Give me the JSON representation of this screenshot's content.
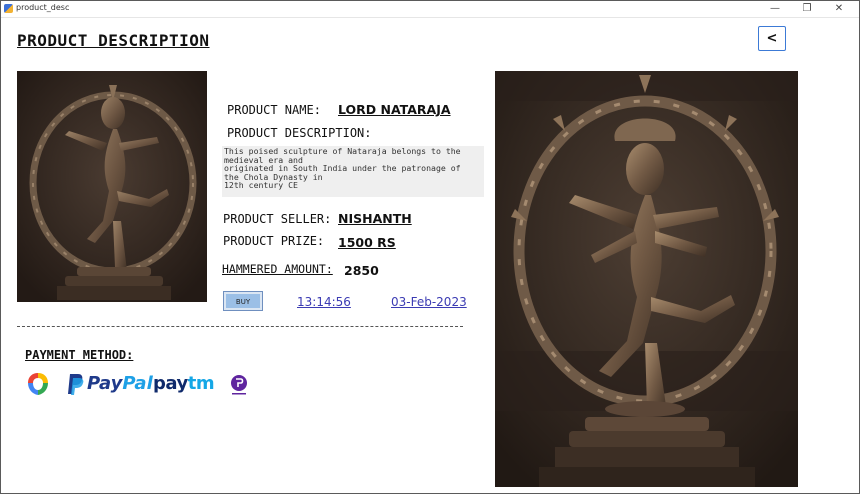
{
  "window": {
    "title": "product_desc",
    "controls": {
      "minimize": "—",
      "maximize": "❐",
      "close": "✕"
    }
  },
  "header": {
    "title": "PRODUCT DESCRIPTION",
    "back_label": "<"
  },
  "product": {
    "name_label": "PRODUCT NAME:",
    "name_value": "LORD NATARAJA",
    "description_label": "PRODUCT DESCRIPTION:",
    "description_text": "This poised sculpture of Nataraja belongs to the\nmedieval era and\noriginated in South India under the patronage of\nthe Chola Dynasty in\n12th century CE",
    "seller_label": "PRODUCT SELLER:",
    "seller_value": "NISHANTH",
    "prize_label": "PRODUCT PRIZE:",
    "prize_value": "1500 RS",
    "hammered_label": "HAMMERED AMOUNT:",
    "hammered_value": "2850",
    "buy_label": "BUY",
    "time": "13:14:56",
    "date": "03-Feb-2023"
  },
  "payment": {
    "title": "PAYMENT METHOD:",
    "methods": [
      {
        "name": "google-pay",
        "icon": "google-pay-icon"
      },
      {
        "name": "paypal",
        "text": "PayPal",
        "icon": "paypal-icon"
      },
      {
        "name": "paytm",
        "text": "paytm",
        "icon": "paytm-icon"
      },
      {
        "name": "phonepe",
        "icon": "phonepe-icon"
      }
    ]
  },
  "colors": {
    "link": "#3b3bb3",
    "buy_button": "#9bbfe6",
    "back_button_border": "#3c7ad6",
    "paypal_dark": "#1f3a8a",
    "paypal_light": "#1ea0e6",
    "paytm_dark": "#0f2a6b",
    "paytm_light": "#15a7e6",
    "phonepe": "#5f259f"
  }
}
